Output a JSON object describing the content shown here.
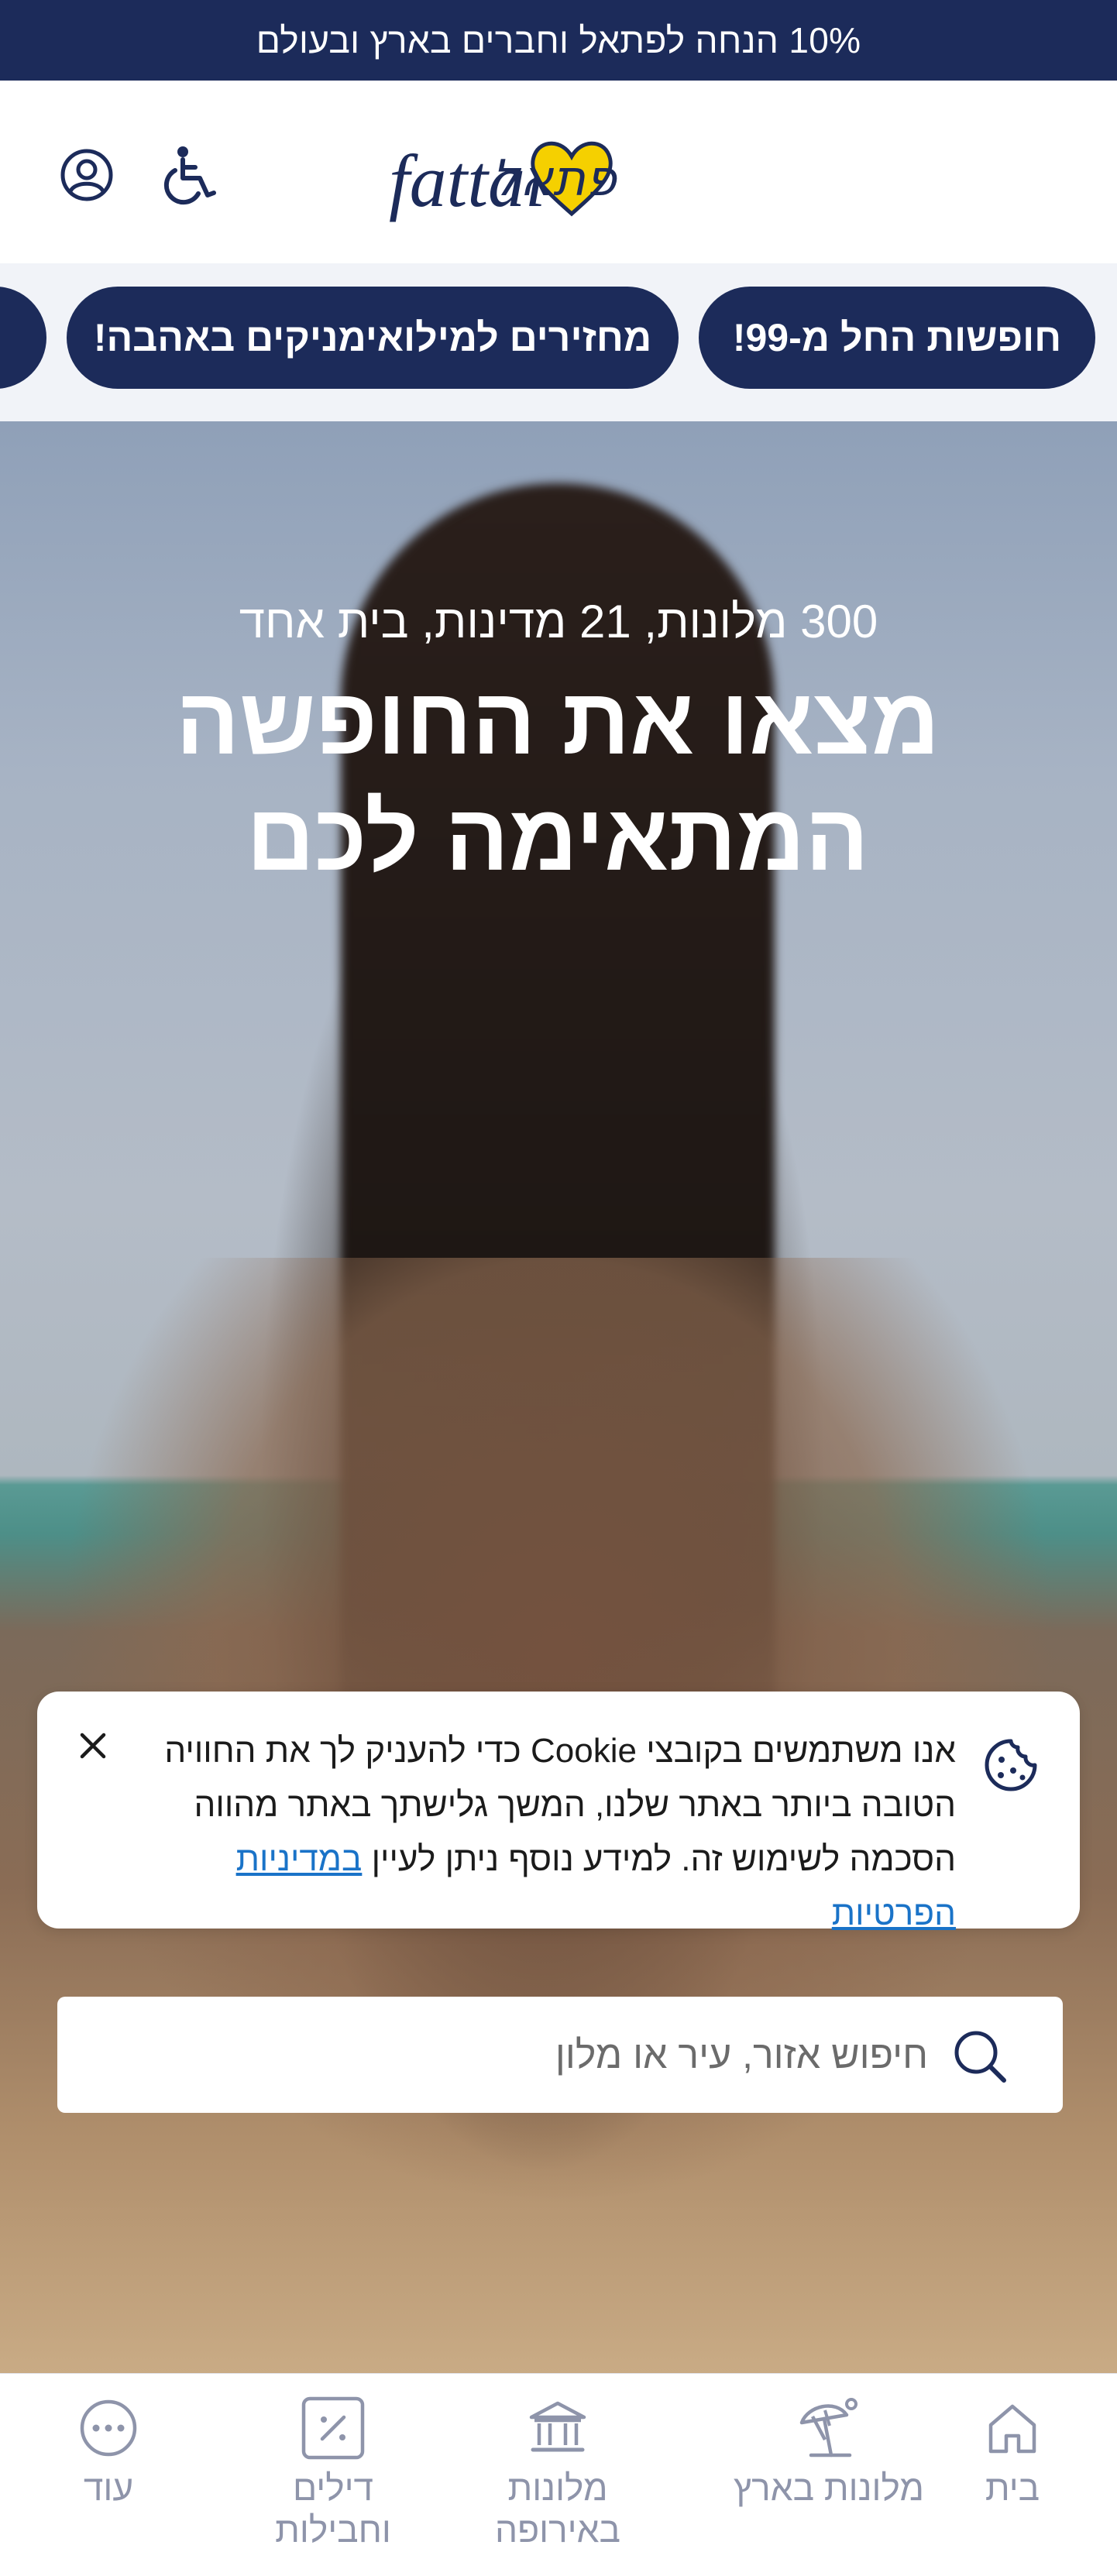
{
  "colors": {
    "brand_navy": "#1c2b5a",
    "brand_yellow": "#f5d000",
    "nav_inactive": "#8e94aa",
    "link_blue": "#1a73c8"
  },
  "promo": {
    "text": "10% הנחה לפתאל וחברים בארץ ובעולם"
  },
  "header": {
    "logo_alt": "fattal פתאל",
    "icons": [
      "account-icon",
      "accessibility-icon"
    ]
  },
  "chips": [
    {
      "label": "חופשות החל מ-99!"
    },
    {
      "label": "מחזירים למילואימניקים באהבה!"
    },
    {
      "label": ""
    }
  ],
  "hero": {
    "subtitle": "300 מלונות, 21 מדינות, בית אחד",
    "title": "מצאו את החופשה המתאימה לכם"
  },
  "cookie": {
    "text": "אנו משתמשים בקובצי Cookie כדי להעניק לך את החוויה הטובה ביותר באתר שלנו, המשך גלישתך באתר מהווה הסכמה לשימוש זה. למידע נוסף ניתן לעיין ",
    "link_text": "במדיניות הפרטיות",
    "icon": "cookie-icon",
    "close_icon": "close-icon"
  },
  "search": {
    "placeholder": "חיפוש אזור, עיר או מלון",
    "icon": "search-icon"
  },
  "bottom_nav": {
    "items": [
      {
        "label": "בית",
        "icon": "home-icon"
      },
      {
        "label": "מלונות בארץ",
        "icon": "beach-umbrella-icon"
      },
      {
        "label": "מלונות\nבאירופה",
        "icon": "building-columns-icon"
      },
      {
        "label": "דילים\nוחבילות",
        "icon": "discount-tag-icon"
      },
      {
        "label": "עוד",
        "icon": "more-dots-icon"
      }
    ]
  }
}
